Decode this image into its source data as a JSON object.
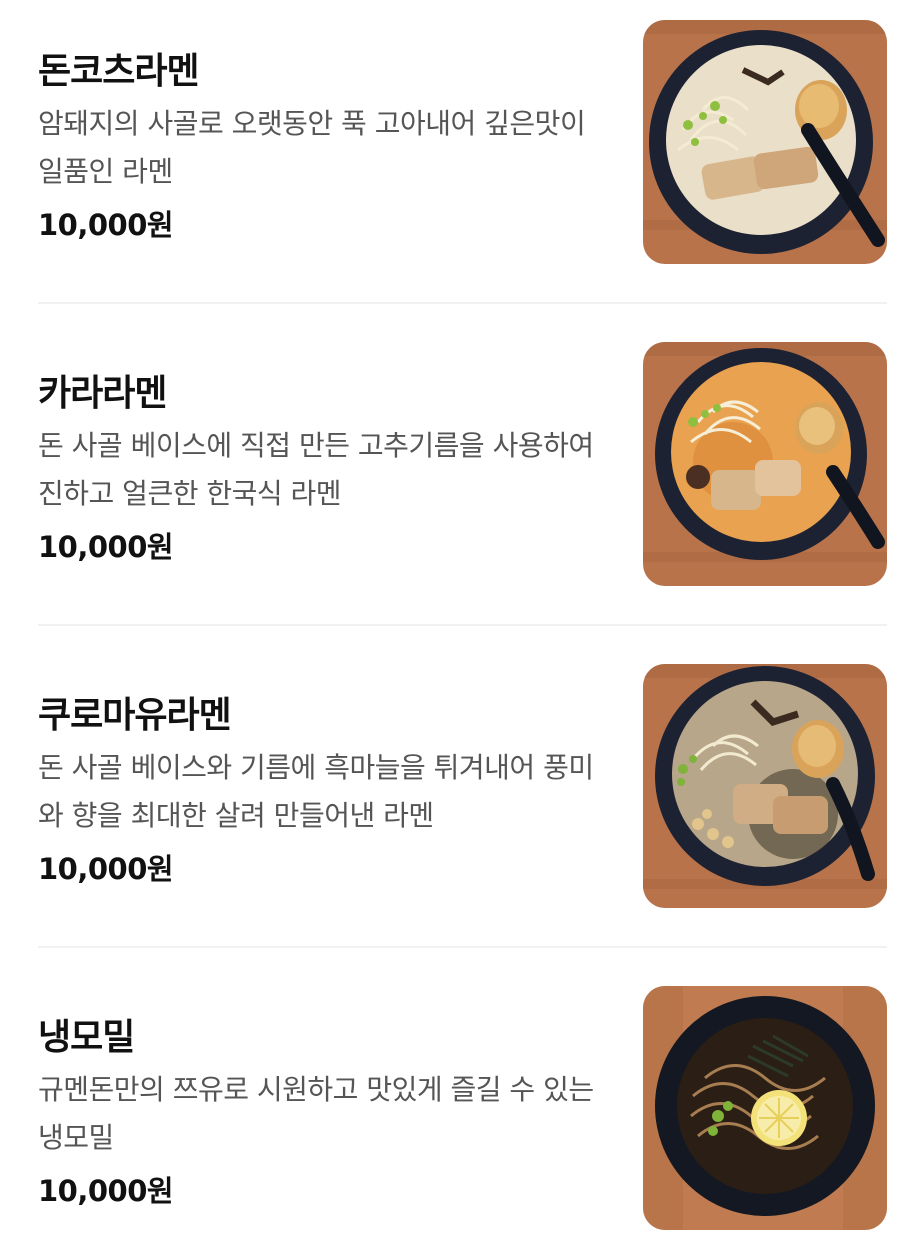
{
  "menu": {
    "items": [
      {
        "name": "돈코츠라멘",
        "description": "암돼지의 사골로 오랫동안 푹 고아내어 깊은맛이 일품인 라멘",
        "price": "10,000원",
        "photo_icon": "tonkotsu-ramen-photo"
      },
      {
        "name": "카라라멘",
        "description": "돈 사골 베이스에 직접 만든 고추기름을 사용하여 진하고 얼큰한 한국식 라멘",
        "price": "10,000원",
        "photo_icon": "kara-ramen-photo"
      },
      {
        "name": "쿠로마유라멘",
        "description": "돈 사골 베이스와 기름에 흑마늘을 튀겨내어 풍미와 향을 최대한 살려 만들어낸 라멘",
        "price": "10,000원",
        "photo_icon": "kuromayu-ramen-photo"
      },
      {
        "name": "냉모밀",
        "description": "규멘돈만의 쯔유로 시원하고 맛있게 즐길 수 있는 냉모밀",
        "price": "10,000원",
        "photo_icon": "cold-soba-photo"
      }
    ]
  },
  "colors": {
    "text": "#111111",
    "muted_text": "#555555",
    "divider": "#f1f1f1",
    "table_wood": "#b8734a",
    "bowl": "#1d2233"
  }
}
